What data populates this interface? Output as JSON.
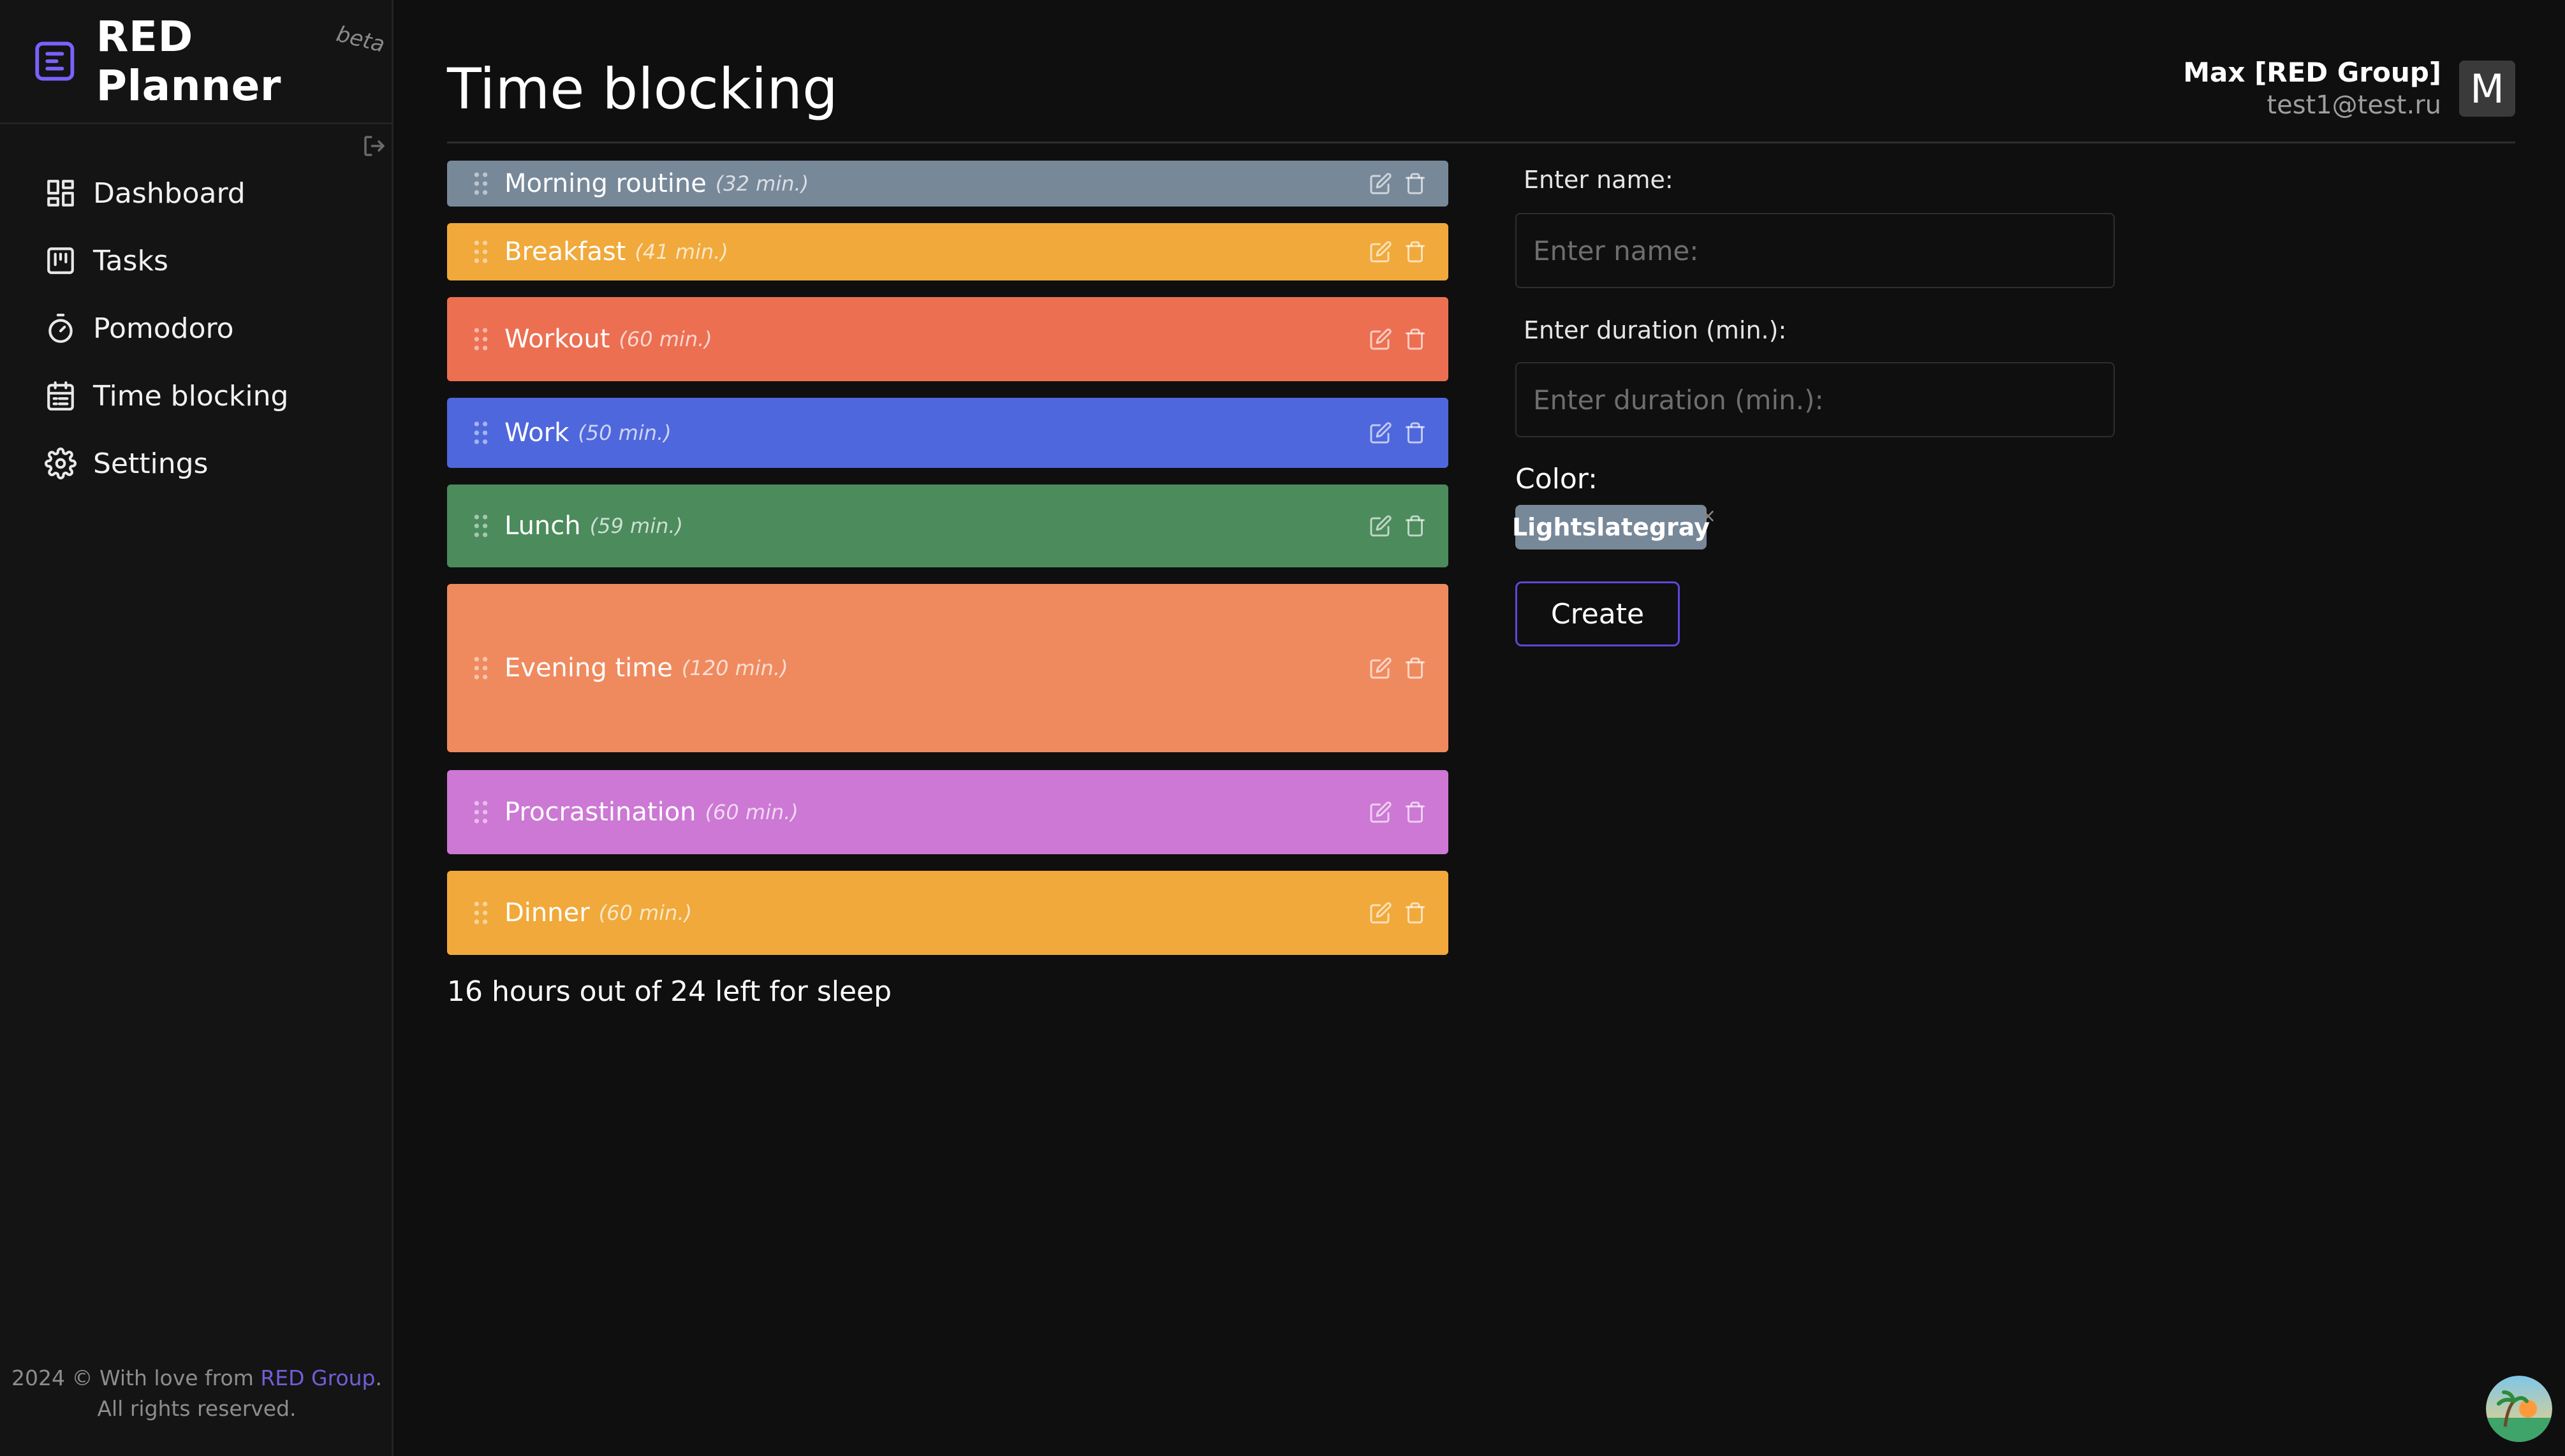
{
  "app": {
    "logo_text": "RED Planner",
    "beta_label": "beta",
    "accent": "#7b61ff"
  },
  "sidebar": {
    "items": [
      {
        "label": "Dashboard",
        "icon": "dashboard-icon"
      },
      {
        "label": "Tasks",
        "icon": "kanban-icon"
      },
      {
        "label": "Pomodoro",
        "icon": "timer-icon"
      },
      {
        "label": "Time blocking",
        "icon": "calendar-icon"
      },
      {
        "label": "Settings",
        "icon": "gear-icon"
      }
    ],
    "footer": {
      "line1_prefix": "2024 © With love from",
      "link": "RED Group",
      "line1_suffix": ".",
      "line2": "All rights reserved."
    }
  },
  "header": {
    "title": "Time blocking",
    "user_name": "Max [RED Group]",
    "user_email": "test1@test.ru",
    "avatar_letter": "M"
  },
  "blocks": [
    {
      "name": "Morning routine",
      "duration": "(32 min.)",
      "color": "#778899"
    },
    {
      "name": "Breakfast",
      "duration": "(41 min.)",
      "color": "#f0a93a"
    },
    {
      "name": "Workout",
      "duration": "(60 min.)",
      "color": "#ec6f52"
    },
    {
      "name": "Work",
      "duration": "(50 min.)",
      "color": "#4f67dc"
    },
    {
      "name": "Lunch",
      "duration": "(59 min.)",
      "color": "#4b8b5c"
    },
    {
      "name": "Evening time",
      "duration": "(120 min.)",
      "color": "#ef8a5f"
    },
    {
      "name": "Procrastination",
      "duration": "(60 min.)",
      "color": "#cc78d4"
    },
    {
      "name": "Dinner",
      "duration": "(60 min.)",
      "color": "#f0a93a"
    }
  ],
  "sleep_text": "16 hours out of 24 left for sleep",
  "form": {
    "name_label": "Enter name:",
    "name_placeholder": "Enter name:",
    "name_value": "",
    "duration_label": "Enter duration (min.):",
    "duration_placeholder": "Enter duration (min.):",
    "duration_value": "",
    "color_label": "Color:",
    "selected_color": "Lightslategray",
    "selected_color_hex": "#778899",
    "create_label": "Create"
  }
}
